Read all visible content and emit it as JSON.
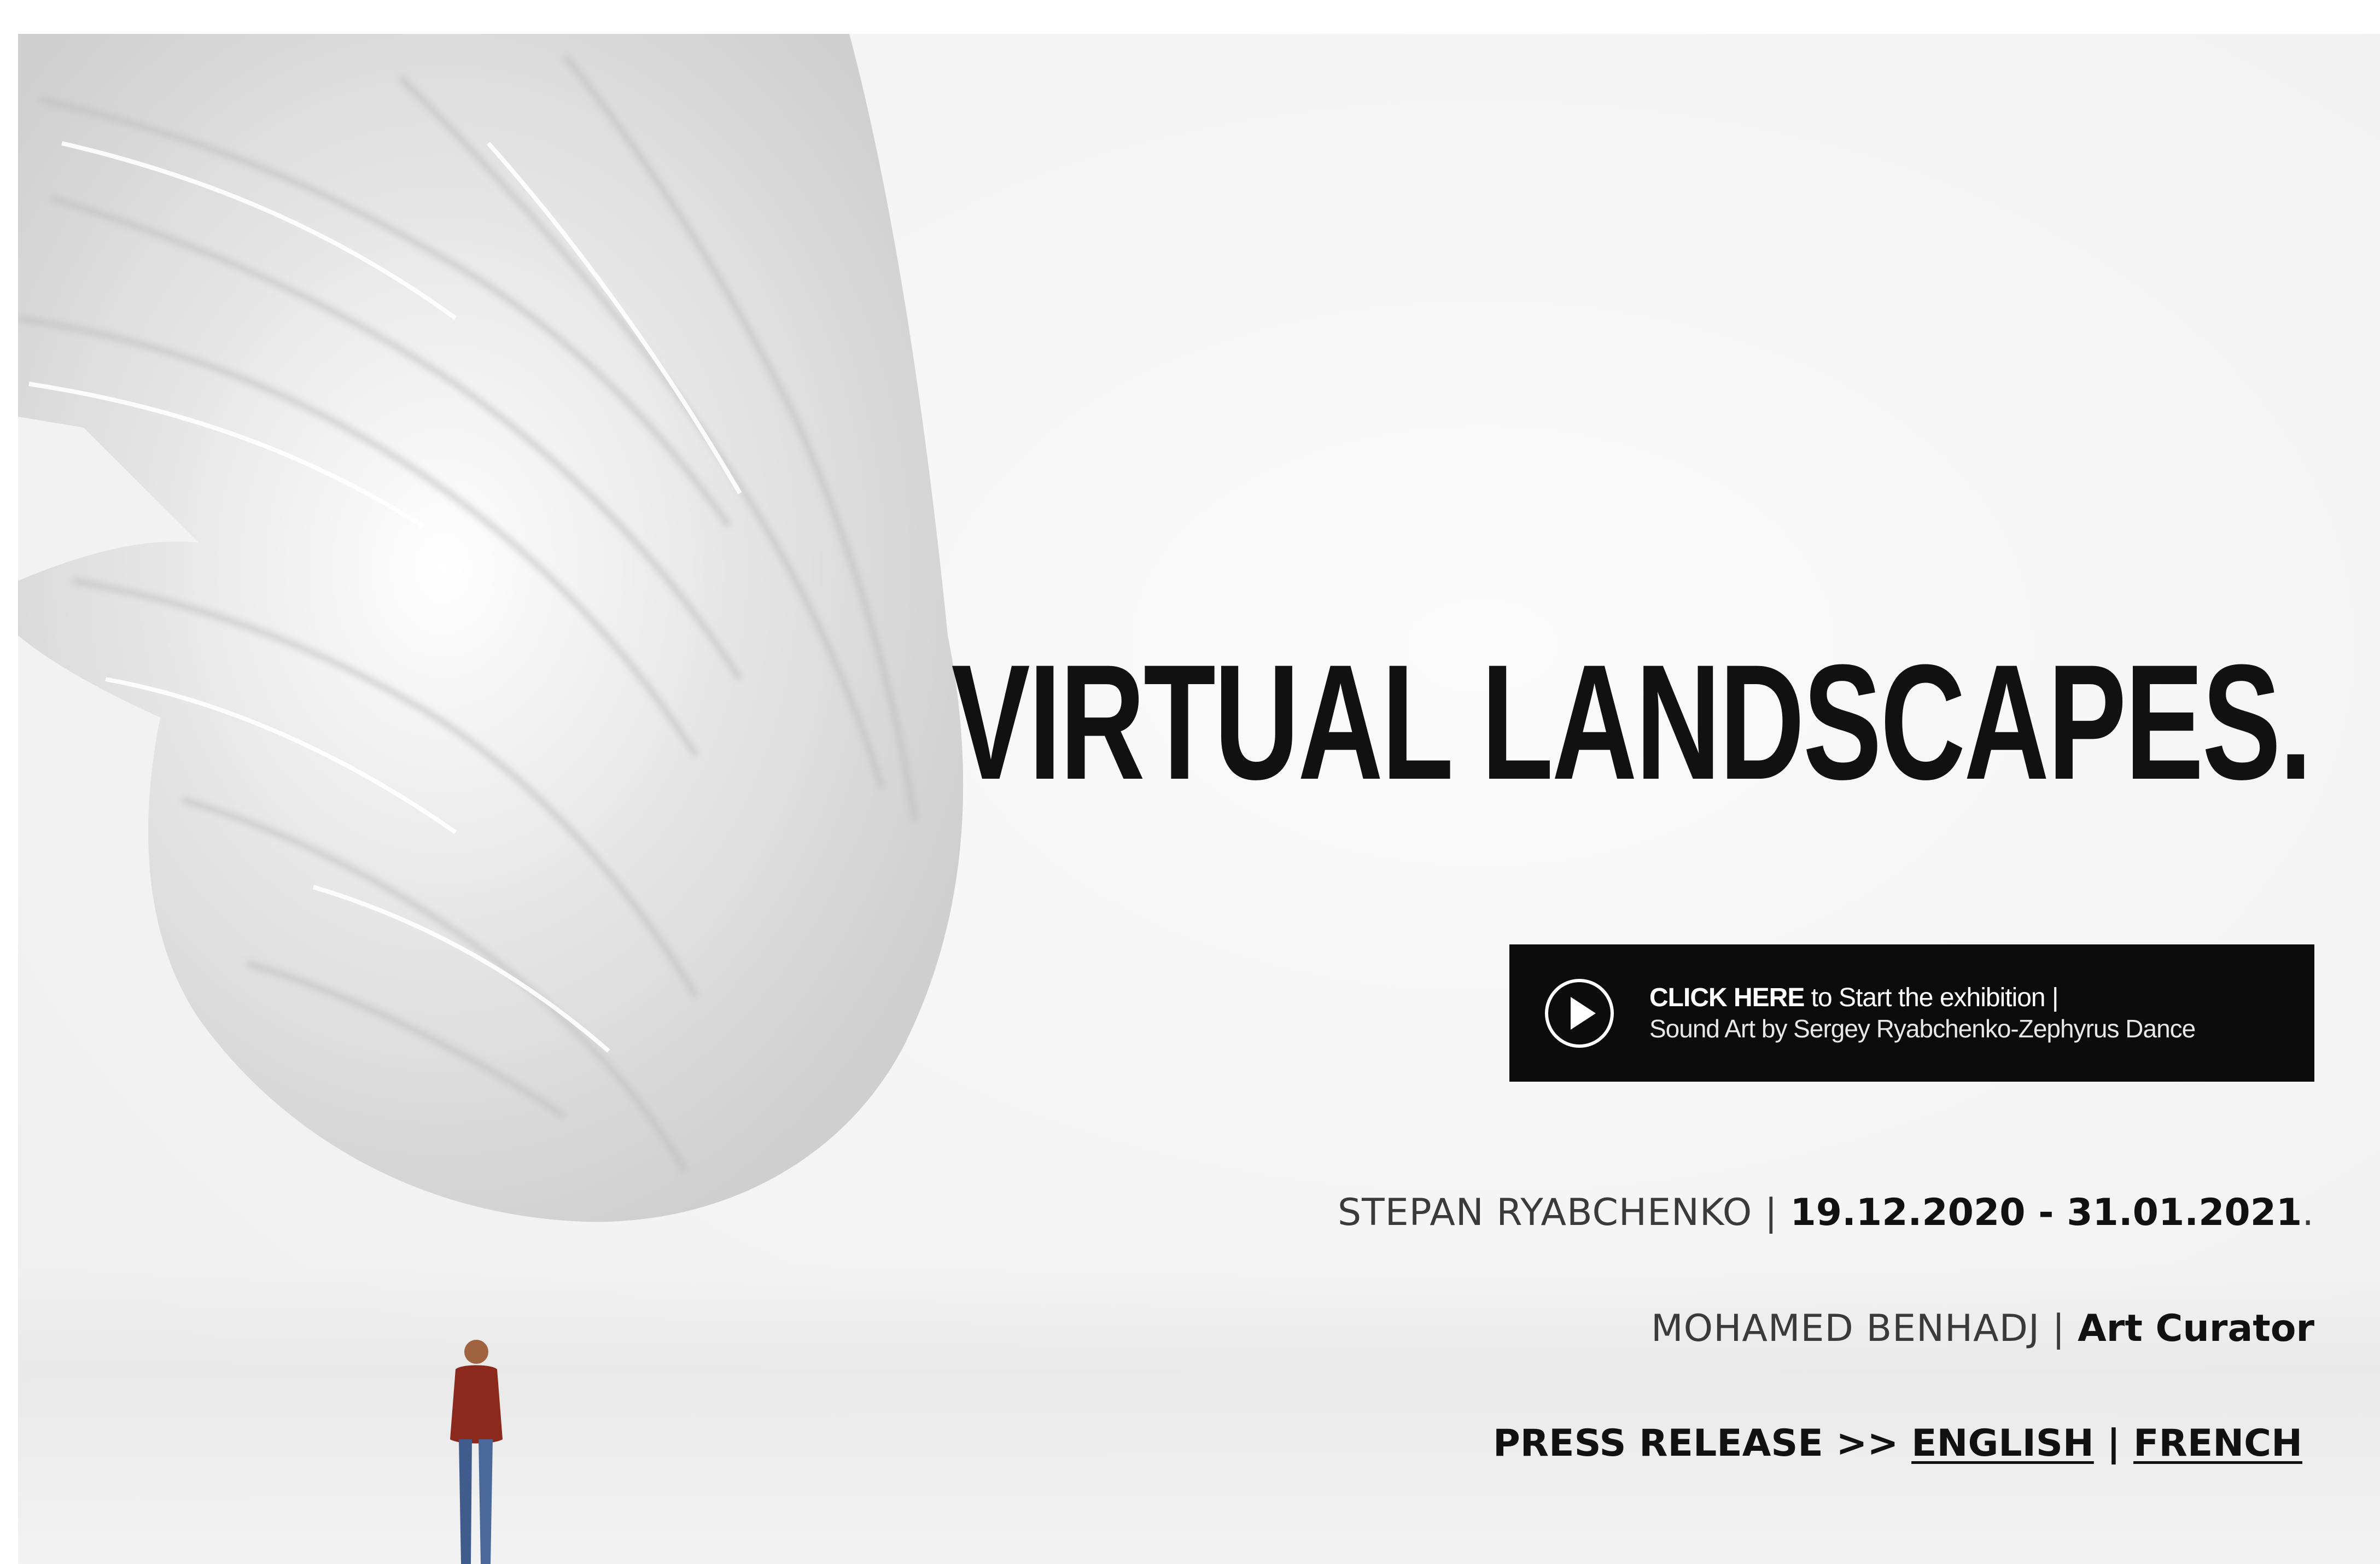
{
  "hero": {
    "title": "VIRTUAL LANDSCAPES."
  },
  "cta": {
    "icon": "play-circle-icon",
    "line1_bold": "CLICK HERE",
    "line1_rest": " to Start the exhibition |",
    "line2": "Sound Art by Sergey Ryabchenko-Zephyrus Dance",
    "background": "#0b0b0b",
    "text_color": "#ffffff"
  },
  "artist": {
    "name": "STEPAN RYABCHENKO",
    "separator": " | ",
    "dates": "19.12.2020 - 31.01.2021",
    "trailing": "."
  },
  "curator": {
    "name": "MOHAMED BENHADJ",
    "separator": " | ",
    "role": "Art Curator"
  },
  "press": {
    "label": "PRESS RELEASE >> ",
    "english": "ENGLISH",
    "separator": " | ",
    "french": "FRENCH"
  }
}
